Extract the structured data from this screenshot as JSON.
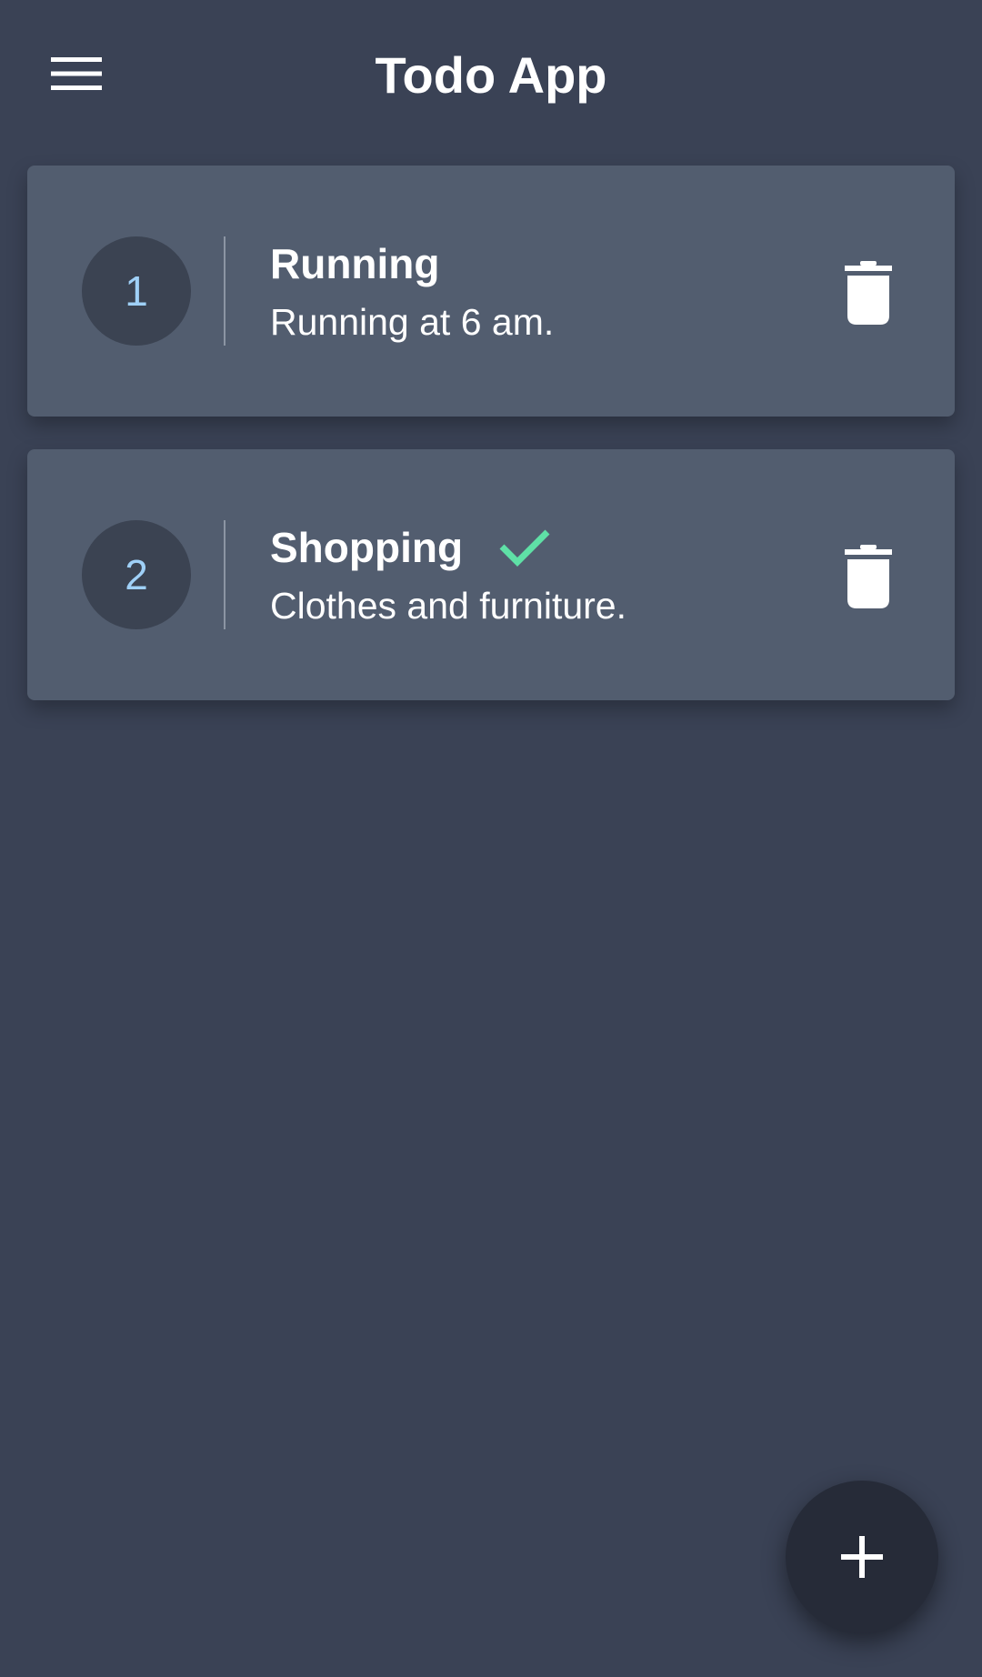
{
  "app_bar": {
    "title": "Todo App",
    "menu_icon": "hamburger-menu-icon"
  },
  "todos": [
    {
      "index": "1",
      "title": "Running",
      "description": "Running at 6 am.",
      "done": false
    },
    {
      "index": "2",
      "title": "Shopping",
      "description": "Clothes and furniture.",
      "done": true
    }
  ],
  "icons": {
    "delete": "trash-icon",
    "done": "checkmark-icon",
    "add": "plus-icon"
  },
  "colors": {
    "background": "#3a4255",
    "card": "#525d6f",
    "badge": "#3b4352",
    "badge_text": "#9fd0f7",
    "done_check": "#5fe0a6",
    "fab": "#262b38"
  }
}
